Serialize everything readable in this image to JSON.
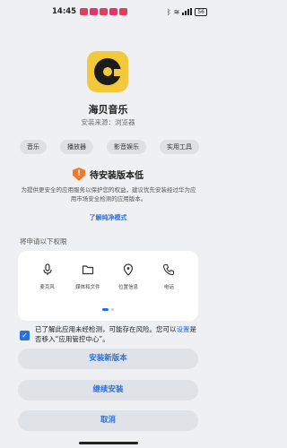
{
  "status_bar": {
    "time": "14:45",
    "battery": "56"
  },
  "app": {
    "name": "海贝音乐",
    "source": "安装来源：浏览器"
  },
  "tags": [
    "音乐",
    "播放器",
    "影音娱乐",
    "实用工具"
  ],
  "warning": {
    "icon": "shield-exclamation-icon",
    "title": "待安装版本低",
    "description": "为提供更安全的应用服务以保护您的权益，建议优先安装经过华为应用市场安全检测的应用版本。",
    "link": "了解纯净模式"
  },
  "permissions": {
    "title": "将申请以下权限",
    "items": [
      {
        "icon": "microphone-icon",
        "label": "麦克风"
      },
      {
        "icon": "folder-icon",
        "label": "媒体和文件"
      },
      {
        "icon": "location-pin-icon",
        "label": "位置信息"
      },
      {
        "icon": "phone-icon",
        "label": "电话"
      }
    ]
  },
  "risk": {
    "checked": true,
    "text_before": "已了解此应用未经检测，可能存在风险。您可以",
    "link": "设置",
    "text_after": "是否移入“应用管控中心”。"
  },
  "buttons": {
    "install_new": "安装新版本",
    "continue": "继续安装",
    "cancel": "取消"
  },
  "colors": {
    "accent": "#2a6fe0",
    "warning": "#f07a2a",
    "app_icon": "#f3c93c"
  }
}
